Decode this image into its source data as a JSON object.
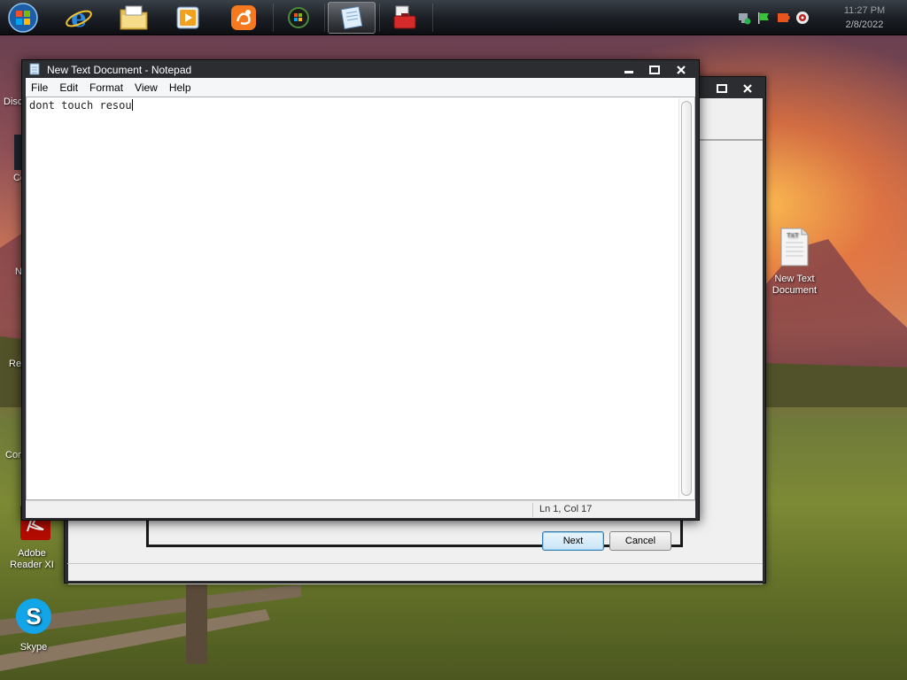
{
  "taskbar": {
    "start_button": "start-orb",
    "pinned": [
      {
        "name": "internet-explorer-icon"
      },
      {
        "name": "file-explorer-icon"
      },
      {
        "name": "media-player-icon"
      },
      {
        "name": "uc-browser-icon"
      },
      {
        "name": "windows-media-center-icon"
      },
      {
        "name": "notepad-icon",
        "active": true
      },
      {
        "name": "toolbox-icon"
      }
    ],
    "tray_icons": [
      "network-icon",
      "flag-icon",
      "power-icon",
      "volume-icon"
    ],
    "clock": {
      "time": "11:27 PM",
      "date": "2/8/2022"
    }
  },
  "desktop": {
    "icons_left": [
      {
        "label": "Disc"
      },
      {
        "label": "Co"
      },
      {
        "label": "N"
      },
      {
        "label": "Re"
      },
      {
        "label": "Con"
      },
      {
        "label": "Adobe Reader XI"
      },
      {
        "label": "Skype"
      }
    ],
    "icon_right": {
      "label": "New Text Document",
      "badge": "TXT"
    }
  },
  "notepad": {
    "title": "New Text Document - Notepad",
    "menu": [
      "File",
      "Edit",
      "Format",
      "View",
      "Help"
    ],
    "content": "dont touch resou",
    "status": "Ln 1, Col 17"
  },
  "wizard": {
    "next_label": "Next",
    "cancel_label": "Cancel"
  },
  "colors": {
    "taskbar": "#1c2026",
    "window_frame": "#2b2d30",
    "close_red": "#c0392b"
  }
}
